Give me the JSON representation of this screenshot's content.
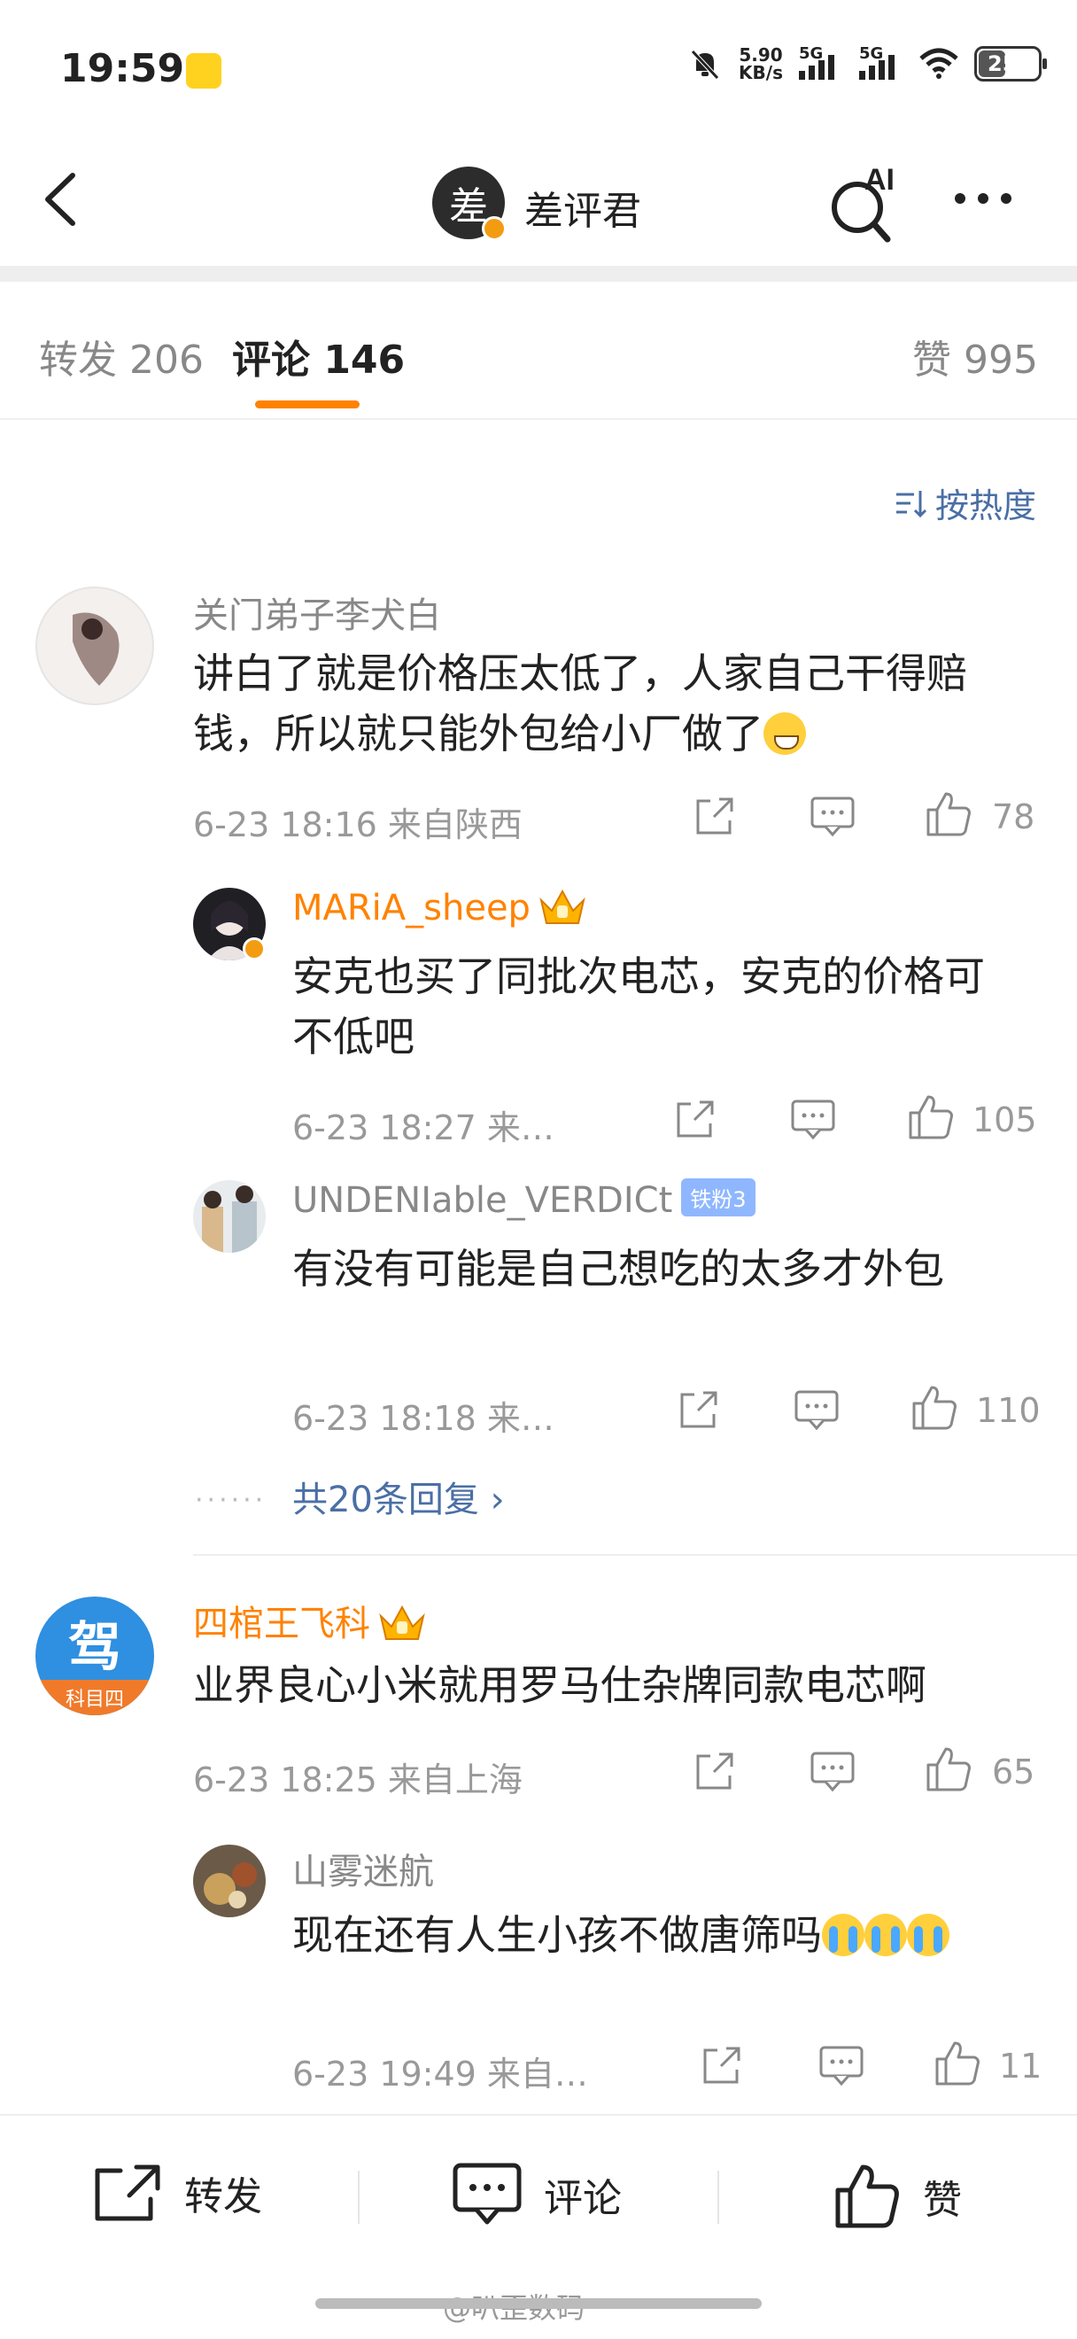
{
  "status_bar": {
    "time": "19:59",
    "net_speed_value": "5.90",
    "net_speed_unit": "KB/s",
    "sig1": "5G",
    "sig2": "5G",
    "battery": "25"
  },
  "nav": {
    "title": "差评君",
    "avatar_char": "差",
    "ai_label": "AI"
  },
  "tabs": [
    {
      "label": "转发 206"
    },
    {
      "label": "评论 146"
    },
    {
      "label": "赞 995"
    }
  ],
  "sort": {
    "label": "按热度"
  },
  "comments": [
    {
      "user": "关门弟子李犬白",
      "text": "讲白了就是价格压太低了，人家自己干得赔钱，所以就只能外包给小厂做了",
      "meta": "6-23 18:16  来自陕西",
      "likes": "78"
    },
    {
      "user": "MARiA_sheep",
      "text": "安克也买了同批次电芯，安克的价格可不低吧",
      "meta": "6-23 18:27  来…",
      "likes": "105"
    },
    {
      "user": "UNDENIable_VERDICt",
      "badge": "铁粉3",
      "text": "有没有可能是自己想吃的太多才外包",
      "meta": "6-23 18:18  来…",
      "likes": "110"
    },
    {
      "user": "四棺王飞科",
      "text": "业界良心小米就用罗马仕杂牌同款电芯啊",
      "meta": "6-23 18:25  来自上海",
      "likes": "65",
      "avatar_text": "科目四"
    },
    {
      "user": "山雾迷航",
      "text": "现在还有人生小孩不做唐筛吗",
      "meta": "6-23 19:49  来自…",
      "likes": "11"
    }
  ],
  "more_replies": "共20条回复 ›",
  "bottom": {
    "repost": "转发",
    "comment": "评论",
    "like": "赞"
  },
  "watermark": "@叭歪数码",
  "colors": {
    "accent": "#ff8200",
    "link": "#4a6fa5"
  }
}
